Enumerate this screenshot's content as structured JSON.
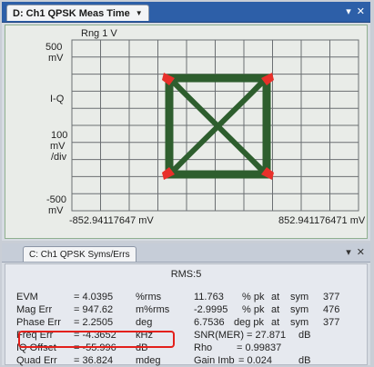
{
  "top_panel": {
    "tab_label": "D: Ch1 QPSK Meas Time",
    "tab_dropdown_icon": "dropdown-arrow-icon",
    "controls": {
      "pin_icon": "chevron-down-icon",
      "close_icon": "close-icon",
      "pin": "▾",
      "close": "✕"
    },
    "plot": {
      "range_label": "Rng 1  V",
      "y_top_value": "500",
      "y_top_unit": "mV",
      "y_mid_label": "I-Q",
      "scale_value": "100",
      "scale_unit": "mV",
      "scale_per": "/div",
      "y_bottom_value": "-500",
      "y_bottom_unit": "mV",
      "x_left_label": "-852.94117647 mV",
      "x_right_label": "852.941176471 mV",
      "trace_color": "#2e5e2e",
      "marker_color": "#e8302a",
      "grid_color": "#6b6f72",
      "background_color": "#e9ece8"
    }
  },
  "bottom_panel": {
    "tab_label": "C: Ch1 QPSK Syms/Errs",
    "controls": {
      "pin": "▾",
      "close": "✕"
    },
    "rms_label": "RMS:5",
    "rows": [
      {
        "name": "EVM",
        "value": "= 4.0395",
        "unit": "%rms",
        "v2": "11.763",
        "u2": "% pk",
        "at": "at",
        "sym": "sym",
        "n": "377"
      },
      {
        "name": "Mag Err",
        "value": "= 947.62",
        "unit": "m%rms",
        "v2": "-2.9995",
        "u2": "% pk",
        "at": "at",
        "sym": "sym",
        "n": "476"
      },
      {
        "name": "Phase Err",
        "value": "= 2.2505",
        "unit": "deg",
        "v2": "6.7536",
        "u2": "deg pk",
        "at": "at",
        "sym": "sym",
        "n": "377"
      },
      {
        "name": "Freq Err",
        "value": "= -4.3652",
        "unit": "kHz",
        "v2": "SNR(MER) = 27.871",
        "u2": "",
        "at": "",
        "sym": "dB",
        "n": ""
      },
      {
        "name": "IQ Offset",
        "value": "= -55.996",
        "unit": "dB",
        "v2": "Rho",
        "u2": "= 0.99837",
        "at": "",
        "sym": "",
        "n": ""
      },
      {
        "name": "Quad Err",
        "value": "= 36.824",
        "unit": "mdeg",
        "v2": "Gain Imb",
        "u2": "= 0.024",
        "at": "",
        "sym": "dB",
        "n": ""
      }
    ],
    "highlight_color": "#e3201b"
  }
}
